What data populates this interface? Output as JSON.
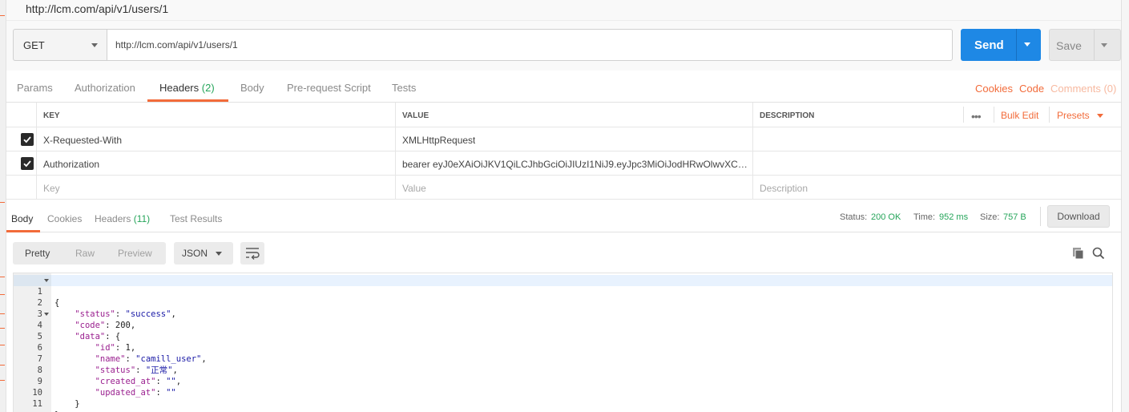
{
  "tab_title": "http://lcm.com/api/v1/users/1",
  "request": {
    "method": "GET",
    "url": "http://lcm.com/api/v1/users/1",
    "send_label": "Send",
    "save_label": "Save"
  },
  "request_tabs": {
    "params": "Params",
    "authorization": "Authorization",
    "headers": "Headers",
    "headers_count": "(2)",
    "body": "Body",
    "pre_request": "Pre-request Script",
    "tests": "Tests",
    "cookies": "Cookies",
    "code": "Code",
    "comments": "Comments (0)"
  },
  "headers_table": {
    "columns": {
      "key": "KEY",
      "value": "VALUE",
      "description": "DESCRIPTION"
    },
    "more": "•••",
    "bulk_edit": "Bulk Edit",
    "presets": "Presets",
    "rows": [
      {
        "checked": true,
        "key": "X-Requested-With",
        "value": "XMLHttpRequest",
        "description": ""
      },
      {
        "checked": true,
        "key": "Authorization",
        "value": "bearer eyJ0eXAiOiJKV1QiLCJhbGciOiJIUzI1NiJ9.eyJpc3MiOiJodHRwOlwvXC9s...",
        "description": ""
      }
    ],
    "placeholders": {
      "key": "Key",
      "value": "Value",
      "description": "Description"
    }
  },
  "response_tabs": {
    "body": "Body",
    "cookies": "Cookies",
    "headers": "Headers",
    "headers_count": "(11)",
    "test_results": "Test Results"
  },
  "response_status": {
    "status_label": "Status:",
    "status_value": "200 OK",
    "time_label": "Time:",
    "time_value": "952 ms",
    "size_label": "Size:",
    "size_value": "757 B",
    "download": "Download"
  },
  "response_toolbar": {
    "pretty": "Pretty",
    "raw": "Raw",
    "preview": "Preview",
    "format": "JSON"
  },
  "response_body": {
    "line_numbers": [
      "1",
      "2",
      "3",
      "4",
      "5",
      "6",
      "7",
      "8",
      "9",
      "10",
      "11"
    ],
    "brace_open": "{",
    "brace_close": "}",
    "status_key": "\"status\"",
    "status_val": "\"success\"",
    "code_key": "\"code\"",
    "code_val": "200",
    "data_key": "\"data\"",
    "id_key": "\"id\"",
    "id_val": "1",
    "name_key": "\"name\"",
    "name_val": "\"camill_user\"",
    "dstatus_key": "\"status\"",
    "dstatus_val": "\"正常\"",
    "created_key": "\"created_at\"",
    "created_val": "\"\"",
    "updated_key": "\"updated_at\"",
    "updated_val": "\"\""
  },
  "colors": {
    "accent": "#f26b3a",
    "send_blue": "#1e88e5",
    "success_green": "#25a55a"
  }
}
